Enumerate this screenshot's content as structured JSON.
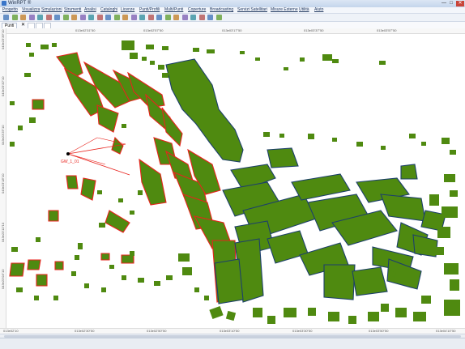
{
  "window": {
    "title": "WinRPT ®",
    "minimize": "—",
    "maximize": "□",
    "close": "✕"
  },
  "menus": [
    "Progetto",
    "Visualizza",
    "Simulazioni",
    "Strumenti",
    "Analisi",
    "Cataloghi",
    "Licenze",
    "Punti/Profili",
    "Multi/Punti",
    "Coperture",
    "Broadcasting",
    "Servizi Satellitari",
    "Misure Esterne",
    "Utilità",
    "Aiuto"
  ],
  "toolbar": {
    "icons": [
      "folder-open-icon",
      "save-icon",
      "print-icon",
      "cut-icon",
      "copy-icon",
      "paste-icon",
      "undo-icon",
      "redo-icon",
      "zoom-in-icon",
      "zoom-out-icon",
      "pan-icon",
      "select-icon",
      "ruler-icon",
      "layers-icon",
      "grid-icon",
      "refresh-icon",
      "measure-icon",
      "profile-icon",
      "antenna-icon",
      "coverage-icon",
      "chart-icon",
      "table-icon",
      "map-icon",
      "settings-icon",
      "info-icon",
      "help-icon"
    ]
  },
  "tab": {
    "label": "Punti",
    "close": "✕"
  },
  "map": {
    "site_label": "GW_1_01",
    "top_ticks": [
      "013e02'31\"50",
      "013e02'57\"50",
      "013e03'17\"50",
      "013e03'37\"50",
      "013e03'57\"50"
    ],
    "bottom_ticks": [
      "013e02'10",
      "013e02'30\"50",
      "013e02'50\"50",
      "013e03'10\"50",
      "013e03'30\"50",
      "013e03'50\"50",
      "013e04'10\"50"
    ],
    "left_ticks": [
      "043e23'39\"10",
      "043e23'32\"10",
      "043e23'25\"10",
      "043e23'18\"10",
      "043e23'11\"10",
      "043e23'04\"10"
    ],
    "colors": {
      "building_fill": "#4f8a10",
      "red_outline": "#e8231d",
      "blue_outline": "#1c3f6b",
      "background": "#ffffff"
    }
  }
}
